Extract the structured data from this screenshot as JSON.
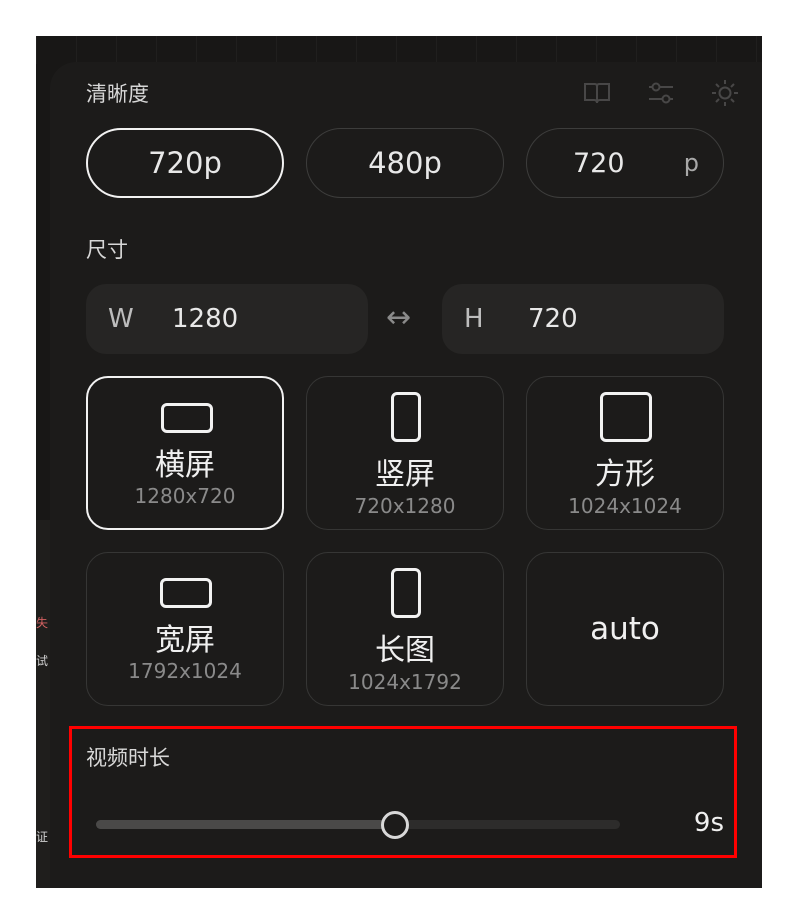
{
  "background_app": {
    "side_texts": [
      "失",
      "试",
      "证"
    ]
  },
  "toolbar": {
    "icons": [
      "book-icon",
      "sliders-icon",
      "brightness-icon"
    ]
  },
  "resolution": {
    "title": "清晰度",
    "options": [
      "720p",
      "480p"
    ],
    "selected": "720p",
    "custom_value": "720",
    "custom_unit": "p"
  },
  "size": {
    "title": "尺寸",
    "width_label": "W",
    "width_value": "1280",
    "height_label": "H",
    "height_value": "720",
    "swap_symbol": "↔"
  },
  "presets": [
    {
      "name": "横屏",
      "size": "1280x720",
      "shape": "landscape",
      "selected": true
    },
    {
      "name": "竖屏",
      "size": "720x1280",
      "shape": "portrait",
      "selected": false
    },
    {
      "name": "方形",
      "size": "1024x1024",
      "shape": "square",
      "selected": false
    },
    {
      "name": "宽屏",
      "size": "1792x1024",
      "shape": "landscape",
      "selected": false
    },
    {
      "name": "长图",
      "size": "1024x1792",
      "shape": "portrait",
      "selected": false
    },
    {
      "name": "auto",
      "size": "",
      "shape": "none",
      "selected": false
    }
  ],
  "duration": {
    "title": "视频时长",
    "value": "9s",
    "slider_fraction": 0.57
  },
  "colors": {
    "highlight": "#ff0000",
    "panel": "#1c1b1a",
    "accent_border": "#f2f2f2"
  }
}
